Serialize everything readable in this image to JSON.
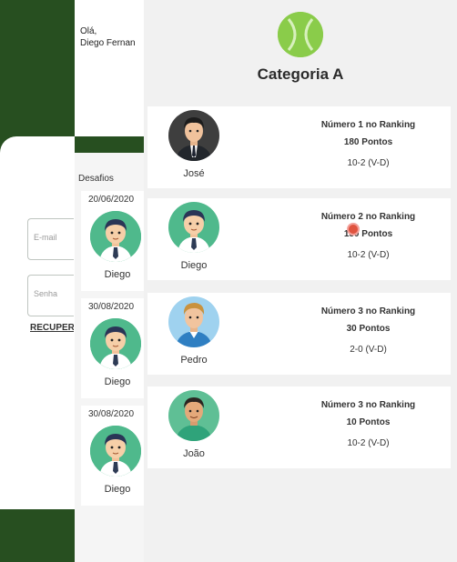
{
  "background_login": {
    "email_placeholder": "E-mail",
    "password_placeholder": "Senha",
    "recover_link": "RECUPER"
  },
  "background_home": {
    "greeting_line1": "Olá,",
    "greeting_line2": "Diego Fernan",
    "section_title": "Desafios",
    "challenges": [
      {
        "date": "20/06/2020",
        "player": "Diego"
      },
      {
        "date": "30/08/2020",
        "player": "Diego"
      },
      {
        "date": "30/08/2020",
        "player": "Diego"
      }
    ]
  },
  "ranking": {
    "title": "Categoria A",
    "players": [
      {
        "name": "José",
        "rank": "Número 1 no Ranking",
        "points": "180 Pontos",
        "record": "10-2 (V-D)",
        "avatar": "man-in-suit-avatar"
      },
      {
        "name": "Diego",
        "rank": "Número 2 no Ranking",
        "points": "150 Pontos",
        "record": "10-2 (V-D)",
        "avatar": "man-green-background-avatar"
      },
      {
        "name": "Pedro",
        "rank": "Número 3 no Ranking",
        "points": "30 Pontos",
        "record": "2-0 (V-D)",
        "avatar": "blonde-man-avatar"
      },
      {
        "name": "João",
        "rank": "Número 3 no Ranking",
        "points": "10 Pontos",
        "record": "10-2 (V-D)",
        "avatar": "man-green-shirt-avatar"
      }
    ]
  },
  "colors": {
    "brand_dark_green": "#274f20",
    "logo_green": "#8acc4a",
    "avatar_green": "#4fb98c"
  }
}
